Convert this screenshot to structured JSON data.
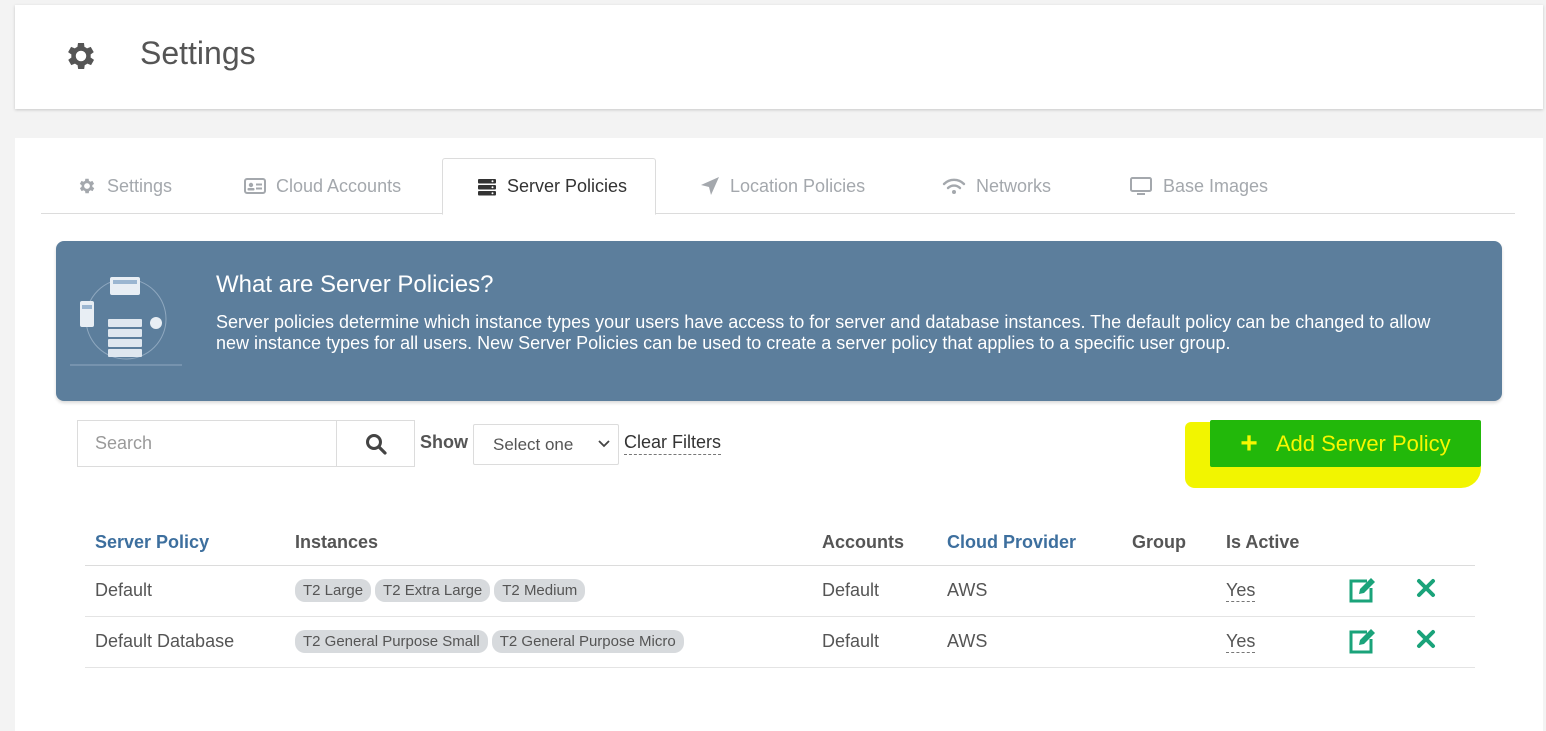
{
  "header": {
    "title": "Settings",
    "icon": "gear-icon"
  },
  "tabs": [
    {
      "label": "Settings",
      "icon": "gear-icon"
    },
    {
      "label": "Cloud Accounts",
      "icon": "id-card-icon"
    },
    {
      "label": "Server Policies",
      "icon": "server-icon",
      "active": true
    },
    {
      "label": "Location Policies",
      "icon": "location-arrow-icon"
    },
    {
      "label": "Networks",
      "icon": "wifi-icon"
    },
    {
      "label": "Base Images",
      "icon": "monitor-icon"
    }
  ],
  "info": {
    "title": "What are Server Policies?",
    "description": "Server policies determine which instance types your users have access to for server and database instances. The default policy can be changed to allow new instance types for all users. New Server Policies can be used to create a server policy that applies to a specific user group."
  },
  "filters": {
    "search_placeholder": "Search",
    "show_label": "Show",
    "select_value": "Select one",
    "clear_label": "Clear Filters"
  },
  "add_button": {
    "label": "Add Server Policy"
  },
  "table": {
    "headers": {
      "policy": "Server Policy",
      "instances": "Instances",
      "accounts": "Accounts",
      "provider": "Cloud Provider",
      "group": "Group",
      "active": "Is Active"
    },
    "rows": [
      {
        "policy": "Default",
        "instances": [
          "T2 Large",
          "T2 Extra Large",
          "T2 Medium"
        ],
        "accounts": "Default",
        "provider": "AWS",
        "group": "",
        "active": "Yes"
      },
      {
        "policy": "Default Database",
        "instances": [
          "T2 General Purpose Small",
          "T2 General Purpose Micro"
        ],
        "accounts": "Default",
        "provider": "AWS",
        "group": "",
        "active": "Yes"
      }
    ]
  },
  "colors": {
    "banner": "#5c7e9c",
    "add_button": "#22b80a",
    "highlight": "#f2f500",
    "link": "#3d6f9e",
    "action": "#1aa37a"
  }
}
